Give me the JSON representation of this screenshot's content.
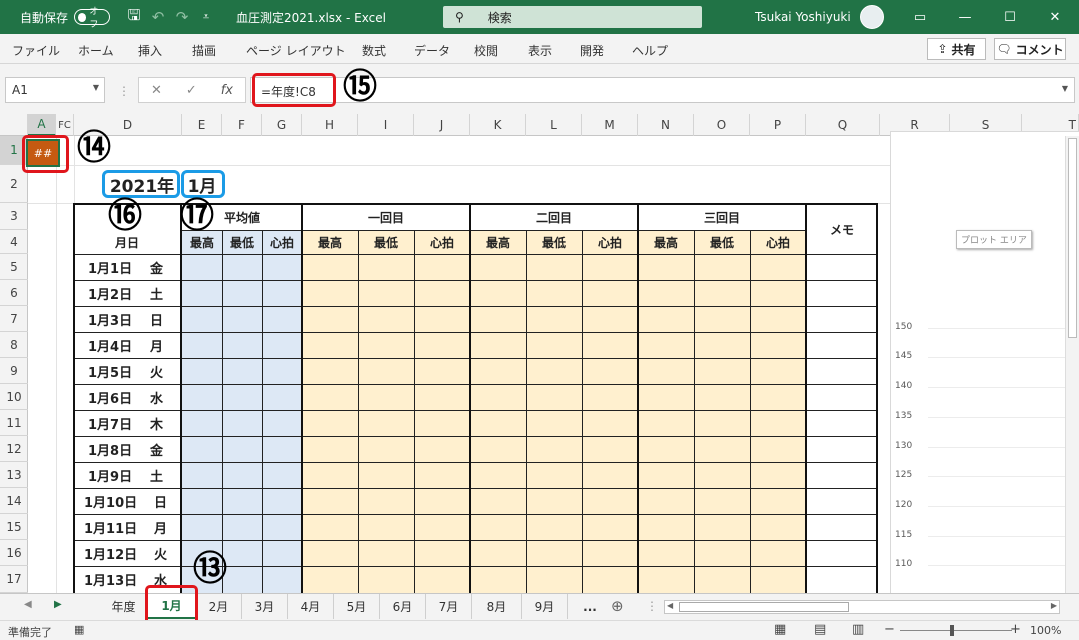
{
  "titlebar": {
    "autosave_label": "自動保存",
    "autosave_state": "オフ",
    "filename": "血圧測定2021.xlsx",
    "app_sep": "-",
    "app_name": "Excel",
    "search_label": "検索",
    "user_name": "Tsukai Yoshiyuki",
    "accent_color": "#217346"
  },
  "ribbon": {
    "tabs": [
      "ファイル",
      "ホーム",
      "挿入",
      "描画",
      "ページ レイアウト",
      "数式",
      "データ",
      "校閲",
      "表示",
      "開発",
      "ヘルプ"
    ],
    "share_label": "共有",
    "comment_label": "コメント"
  },
  "formulabar": {
    "name_box": "A1",
    "fx_label": "fx",
    "formula": "=年度!C8"
  },
  "columns": [
    "A",
    "FC",
    "D",
    "E",
    "F",
    "G",
    "H",
    "I",
    "J",
    "K",
    "L",
    "M",
    "N",
    "O",
    "P",
    "Q",
    "R",
    "S",
    "T"
  ],
  "rows": [
    "1",
    "2",
    "3",
    "4",
    "5",
    "6",
    "7",
    "8",
    "9",
    "10",
    "11",
    "12",
    "13",
    "14",
    "15",
    "16",
    "17"
  ],
  "sheet": {
    "a1_value": "##",
    "year": "2021年",
    "month": "1月",
    "header_date": "月日",
    "header_avg": "平均値",
    "header_first": "一回目",
    "header_second": "二回目",
    "header_third": "三回目",
    "header_memo": "メモ",
    "sub_headers": [
      "最高",
      "最低",
      "心拍",
      "最高",
      "最低",
      "心拍",
      "最高",
      "最低",
      "心拍",
      "最高",
      "最低",
      "心拍"
    ],
    "dates": [
      {
        "date": "1月1日",
        "day": "金"
      },
      {
        "date": "1月2日",
        "day": "土"
      },
      {
        "date": "1月3日",
        "day": "日"
      },
      {
        "date": "1月4日",
        "day": "月"
      },
      {
        "date": "1月5日",
        "day": "火"
      },
      {
        "date": "1月6日",
        "day": "水"
      },
      {
        "date": "1月7日",
        "day": "木"
      },
      {
        "date": "1月8日",
        "day": "金"
      },
      {
        "date": "1月9日",
        "day": "土"
      },
      {
        "date": "1月10日",
        "day": "日"
      },
      {
        "date": "1月11日",
        "day": "月"
      },
      {
        "date": "1月12日",
        "day": "火"
      },
      {
        "date": "1月13日",
        "day": "水"
      }
    ]
  },
  "chart": {
    "yticks": [
      "150",
      "145",
      "140",
      "135",
      "130",
      "125",
      "120",
      "115",
      "110"
    ],
    "tooltip": "プロット エリア"
  },
  "callouts": {
    "c13": "⑬",
    "c14": "⑭",
    "c15": "⑮",
    "c16": "⑯",
    "c17": "⑰"
  },
  "sheettabs": {
    "tabs": [
      "年度",
      "1月",
      "2月",
      "3月",
      "4月",
      "5月",
      "6月",
      "7月",
      "8月",
      "9月"
    ],
    "more": "...",
    "active_index": 1
  },
  "statusbar": {
    "status": "準備完了",
    "zoom": "100%"
  }
}
